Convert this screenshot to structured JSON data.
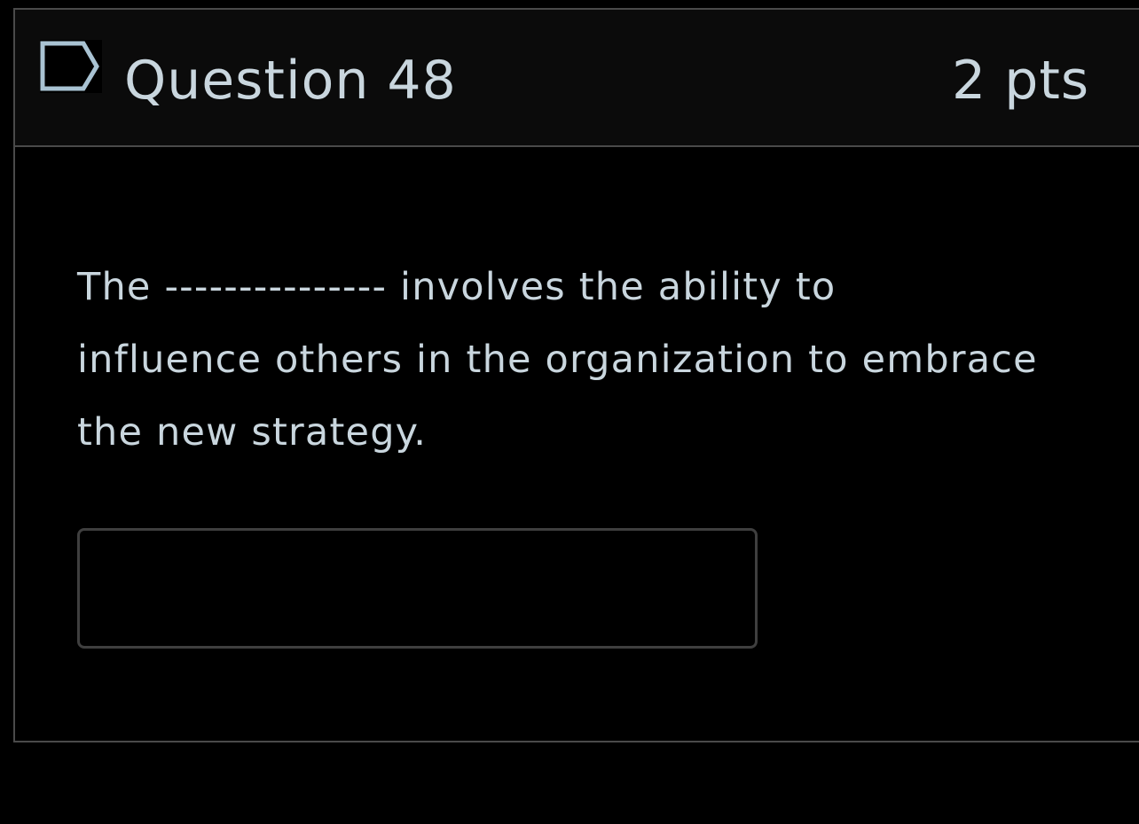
{
  "question": {
    "title": "Question 48",
    "points": "2 pts",
    "flag_icon": "flag-outline-icon",
    "text_lines": [
      "The --------------- involves the ability to",
      "influence others in the organization to embrace",
      "the new strategy."
    ],
    "answer_value": ""
  },
  "colors": {
    "background": "#000000",
    "header_background": "#0b0b0b",
    "border": "#4a4a4a",
    "text": "#c9d6de",
    "input_border": "#3f3f3f"
  }
}
